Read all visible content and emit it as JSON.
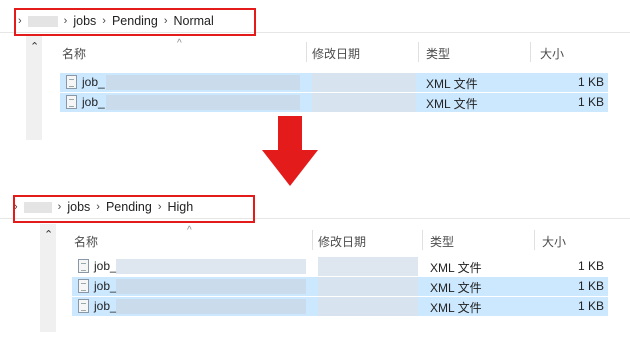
{
  "top": {
    "breadcrumb": [
      "jobs",
      "Pending",
      "Normal"
    ],
    "columns": {
      "name": "名称",
      "date": "修改日期",
      "type": "类型",
      "size": "大小"
    },
    "files": [
      {
        "name": "job_",
        "type": "XML 文件",
        "size": "1 KB",
        "selected": true
      },
      {
        "name": "job_",
        "type": "XML 文件",
        "size": "1 KB",
        "selected": true
      }
    ]
  },
  "bottom": {
    "breadcrumb": [
      "jobs",
      "Pending",
      "High"
    ],
    "columns": {
      "name": "名称",
      "date": "修改日期",
      "type": "类型",
      "size": "大小"
    },
    "files": [
      {
        "name": "job_",
        "type": "XML 文件",
        "size": "1 KB",
        "selected": false
      },
      {
        "name": "job_",
        "type": "XML 文件",
        "size": "1 KB",
        "selected": true
      },
      {
        "name": "job_",
        "type": "XML 文件",
        "size": "1 KB",
        "selected": true
      }
    ]
  },
  "colors": {
    "highlight": "#e41b1b",
    "selection": "#cce8ff"
  },
  "icons": {
    "separator": "chevron-right-icon",
    "file": "xml-file-icon",
    "arrow": "down-arrow-icon",
    "collapse": "chevron-up-icon"
  }
}
